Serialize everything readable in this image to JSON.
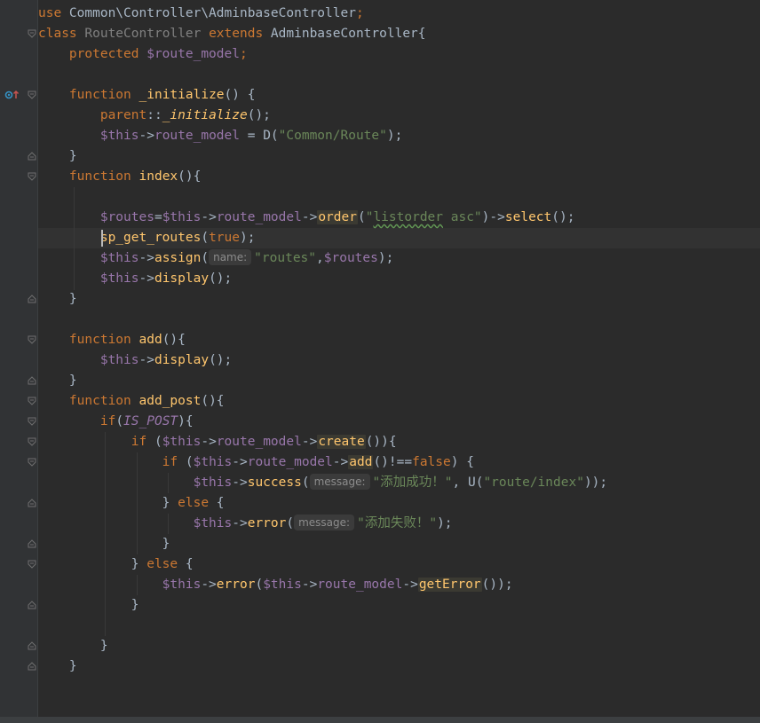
{
  "editor": {
    "lines": [
      {
        "segments": [
          {
            "t": "use ",
            "c": "kw"
          },
          {
            "t": "Common\\Controller\\AdminbaseController",
            "c": "cls"
          },
          {
            "t": ";",
            "c": "kw"
          }
        ]
      },
      {
        "segments": [
          {
            "t": "class ",
            "c": "kw"
          },
          {
            "t": "RouteController ",
            "c": "dim"
          },
          {
            "t": "extends ",
            "c": "kw"
          },
          {
            "t": "AdminbaseController{",
            "c": "cls"
          }
        ]
      },
      {
        "segments": [
          {
            "t": "    protected ",
            "c": "kw"
          },
          {
            "t": "$route_model",
            "c": "var"
          },
          {
            "t": ";",
            "c": "kw"
          }
        ]
      },
      {
        "segments": []
      },
      {
        "segments": [
          {
            "t": "    function ",
            "c": "kw"
          },
          {
            "t": "_initialize",
            "c": "fn"
          },
          {
            "t": "() {",
            "c": "cls"
          }
        ]
      },
      {
        "segments": [
          {
            "t": "        parent",
            "c": "kw"
          },
          {
            "t": "::",
            "c": "cls"
          },
          {
            "t": "_initialize",
            "c": "fn ital"
          },
          {
            "t": "();",
            "c": "cls"
          }
        ]
      },
      {
        "segments": [
          {
            "t": "        $this",
            "c": "var"
          },
          {
            "t": "->",
            "c": "cls"
          },
          {
            "t": "route_model",
            "c": "var"
          },
          {
            "t": " = D(",
            "c": "cls"
          },
          {
            "t": "\"Common/Route\"",
            "c": "str"
          },
          {
            "t": ");",
            "c": "cls"
          }
        ]
      },
      {
        "segments": [
          {
            "t": "    }",
            "c": "cls"
          }
        ]
      },
      {
        "segments": [
          {
            "t": "    function ",
            "c": "kw"
          },
          {
            "t": "index",
            "c": "fn"
          },
          {
            "t": "(){",
            "c": "cls"
          }
        ]
      },
      {
        "segments": []
      },
      {
        "segments": [
          {
            "t": "        $routes",
            "c": "var"
          },
          {
            "t": "=",
            "c": "cls"
          },
          {
            "t": "$this",
            "c": "var"
          },
          {
            "t": "->",
            "c": "cls"
          },
          {
            "t": "route_model",
            "c": "var"
          },
          {
            "t": "->",
            "c": "cls"
          },
          {
            "t": "order",
            "c": "match"
          },
          {
            "t": "(",
            "c": "cls"
          },
          {
            "t": "\"",
            "c": "str"
          },
          {
            "t": "listorder",
            "c": "str squiggle"
          },
          {
            "t": " asc\"",
            "c": "str"
          },
          {
            "t": ")->",
            "c": "cls"
          },
          {
            "t": "select",
            "c": "fn"
          },
          {
            "t": "();",
            "c": "cls"
          }
        ]
      },
      {
        "segments": [
          {
            "t": "        sp_get_routes",
            "c": "fn"
          },
          {
            "t": "(",
            "c": "cls"
          },
          {
            "t": "true",
            "c": "kw"
          },
          {
            "t": ");",
            "c": "cls"
          }
        ]
      },
      {
        "segments": [
          {
            "t": "        $this",
            "c": "var"
          },
          {
            "t": "->",
            "c": "cls"
          },
          {
            "t": "assign",
            "c": "fn"
          },
          {
            "t": "(",
            "c": "cls"
          },
          {
            "t": "name:",
            "c": "inlay"
          },
          {
            "t": "\"routes\"",
            "c": "str"
          },
          {
            "t": ",",
            "c": "cls"
          },
          {
            "t": "$routes",
            "c": "var"
          },
          {
            "t": ");",
            "c": "cls"
          }
        ]
      },
      {
        "segments": [
          {
            "t": "        $this",
            "c": "var"
          },
          {
            "t": "->",
            "c": "cls"
          },
          {
            "t": "display",
            "c": "fn"
          },
          {
            "t": "();",
            "c": "cls"
          }
        ]
      },
      {
        "segments": [
          {
            "t": "    }",
            "c": "cls"
          }
        ]
      },
      {
        "segments": []
      },
      {
        "segments": [
          {
            "t": "    function ",
            "c": "kw"
          },
          {
            "t": "add",
            "c": "fn"
          },
          {
            "t": "(){",
            "c": "cls"
          }
        ]
      },
      {
        "segments": [
          {
            "t": "        $this",
            "c": "var"
          },
          {
            "t": "->",
            "c": "cls"
          },
          {
            "t": "display",
            "c": "fn"
          },
          {
            "t": "();",
            "c": "cls"
          }
        ]
      },
      {
        "segments": [
          {
            "t": "    }",
            "c": "cls"
          }
        ]
      },
      {
        "segments": [
          {
            "t": "    function ",
            "c": "kw"
          },
          {
            "t": "add_post",
            "c": "fn"
          },
          {
            "t": "(){",
            "c": "cls"
          }
        ]
      },
      {
        "segments": [
          {
            "t": "        if",
            "c": "kw"
          },
          {
            "t": "(",
            "c": "cls"
          },
          {
            "t": "IS_POST",
            "c": "var ital"
          },
          {
            "t": "){",
            "c": "cls"
          }
        ]
      },
      {
        "segments": [
          {
            "t": "            if ",
            "c": "kw"
          },
          {
            "t": "(",
            "c": "cls"
          },
          {
            "t": "$this",
            "c": "var"
          },
          {
            "t": "->",
            "c": "cls"
          },
          {
            "t": "route_model",
            "c": "var"
          },
          {
            "t": "->",
            "c": "cls"
          },
          {
            "t": "create",
            "c": "match"
          },
          {
            "t": "()){",
            "c": "cls"
          }
        ]
      },
      {
        "segments": [
          {
            "t": "                if ",
            "c": "kw"
          },
          {
            "t": "(",
            "c": "cls"
          },
          {
            "t": "$this",
            "c": "var"
          },
          {
            "t": "->",
            "c": "cls"
          },
          {
            "t": "route_model",
            "c": "var"
          },
          {
            "t": "->",
            "c": "cls"
          },
          {
            "t": "add",
            "c": "match"
          },
          {
            "t": "()!==",
            "c": "cls"
          },
          {
            "t": "false",
            "c": "kw"
          },
          {
            "t": ") {",
            "c": "cls"
          }
        ]
      },
      {
        "segments": [
          {
            "t": "                    $this",
            "c": "var"
          },
          {
            "t": "->",
            "c": "cls"
          },
          {
            "t": "success",
            "c": "fn"
          },
          {
            "t": "(",
            "c": "cls"
          },
          {
            "t": "message:",
            "c": "inlay"
          },
          {
            "t": "\"添加成功！\"",
            "c": "str"
          },
          {
            "t": ", U(",
            "c": "cls"
          },
          {
            "t": "\"route/index\"",
            "c": "str"
          },
          {
            "t": "));",
            "c": "cls"
          }
        ]
      },
      {
        "segments": [
          {
            "t": "                } ",
            "c": "cls"
          },
          {
            "t": "else ",
            "c": "kw"
          },
          {
            "t": "{",
            "c": "cls"
          }
        ]
      },
      {
        "segments": [
          {
            "t": "                    $this",
            "c": "var"
          },
          {
            "t": "->",
            "c": "cls"
          },
          {
            "t": "error",
            "c": "fn"
          },
          {
            "t": "(",
            "c": "cls"
          },
          {
            "t": "message:",
            "c": "inlay"
          },
          {
            "t": "\"添加失败！\"",
            "c": "str"
          },
          {
            "t": ");",
            "c": "cls"
          }
        ]
      },
      {
        "segments": [
          {
            "t": "                }",
            "c": "cls"
          }
        ]
      },
      {
        "segments": [
          {
            "t": "            } ",
            "c": "cls"
          },
          {
            "t": "else ",
            "c": "kw"
          },
          {
            "t": "{",
            "c": "cls"
          }
        ]
      },
      {
        "segments": [
          {
            "t": "                $this",
            "c": "var"
          },
          {
            "t": "->",
            "c": "cls"
          },
          {
            "t": "error",
            "c": "fn"
          },
          {
            "t": "(",
            "c": "cls"
          },
          {
            "t": "$this",
            "c": "var"
          },
          {
            "t": "->",
            "c": "cls"
          },
          {
            "t": "route_model",
            "c": "var"
          },
          {
            "t": "->",
            "c": "cls"
          },
          {
            "t": "getError",
            "c": "match"
          },
          {
            "t": "());",
            "c": "cls"
          }
        ]
      },
      {
        "segments": [
          {
            "t": "            }",
            "c": "cls"
          }
        ]
      },
      {
        "segments": []
      },
      {
        "segments": [
          {
            "t": "        }",
            "c": "cls"
          }
        ]
      },
      {
        "segments": [
          {
            "t": "    }",
            "c": "cls"
          }
        ]
      }
    ],
    "gutter_icon": "override-method-icon",
    "fold_markers": [
      "fold-open",
      "fold-open",
      "fold-close",
      "fold-open",
      "fold-close",
      "fold-open",
      "fold-close",
      "fold-open",
      "fold-open",
      "fold-open",
      "fold-open",
      "fold-close",
      "fold-close",
      "fold-open",
      "fold-close",
      "fold-close",
      "fold-close"
    ],
    "colors": {
      "background": "#2b2b2b",
      "keyword": "#cc7832",
      "variable": "#9876aa",
      "function": "#ffc66d",
      "string": "#6a8759",
      "default": "#a9b7c6"
    }
  }
}
